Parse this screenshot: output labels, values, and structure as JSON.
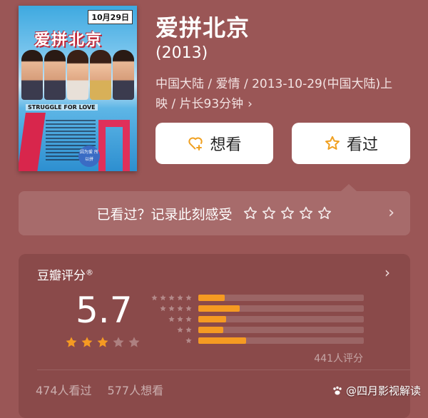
{
  "movie": {
    "title": "爱拼北京",
    "year": "(2013)",
    "meta_line1": "中国大陆 / 爱情 / 2013-10-29(中国大陆)上",
    "meta_line2": "映 / 片长93分钟",
    "meta_chevron": "›"
  },
  "poster": {
    "title": "爱拼北京",
    "date": "10月29日",
    "tagline": "STRUGGLE FOR LOVE",
    "badge": "因为爱 所以拼"
  },
  "actions": {
    "want_label": "想看",
    "seen_label": "看过"
  },
  "record": {
    "prompt": "已看过？记录此刻感受",
    "arrow": "›",
    "star_count": 5
  },
  "rating": {
    "title": "豆瓣评分",
    "trademark": "®",
    "arrow": "›",
    "score": "5.7",
    "score_stars": 3,
    "distribution": [
      {
        "stars": 5,
        "fraction": 0.16
      },
      {
        "stars": 4,
        "fraction": 0.25
      },
      {
        "stars": 3,
        "fraction": 0.17
      },
      {
        "stars": 2,
        "fraction": 0.15
      },
      {
        "stars": 1,
        "fraction": 0.29
      }
    ],
    "count_text": "441人评分",
    "seen_text": "474人看过",
    "want_text": "577人想看"
  },
  "watermark": {
    "text": "@四月影视解读",
    "icon": "paw-icon"
  },
  "colors": {
    "background": "#9a5656",
    "accent": "#f59a22",
    "star_outline": "#e4c84a"
  }
}
